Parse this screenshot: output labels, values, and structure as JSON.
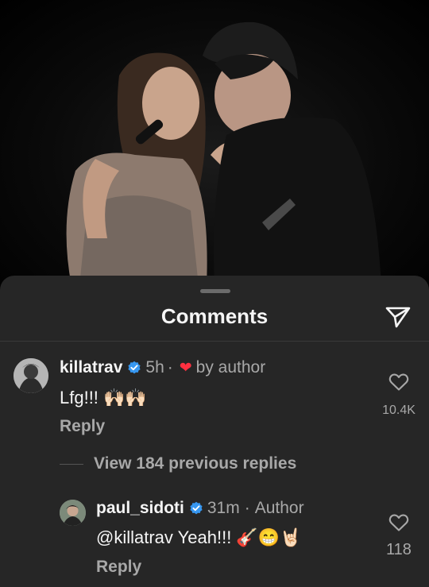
{
  "sheet": {
    "title": "Comments",
    "share_icon": "send-icon"
  },
  "comments": [
    {
      "username": "killatrav",
      "verified": true,
      "time": "5h",
      "separator": "·",
      "liked_by_author": "by author",
      "text": "Lfg!!! 🙌🏻🙌🏻",
      "reply_label": "Reply",
      "like_count": "10.4K"
    }
  ],
  "view_replies": "View 184 previous replies",
  "replies": [
    {
      "username": "paul_sidoti",
      "verified": true,
      "time": "31m",
      "separator": "·",
      "author_tag": "Author",
      "text": "@killatrav Yeah!!! 🎸😁🤘🏻",
      "reply_label": "Reply",
      "like_count": "118"
    }
  ],
  "colors": {
    "sheet_bg": "#262626",
    "verified_blue": "#3797f0",
    "heart_red": "#ff3040",
    "secondary_text": "#a8a8a8"
  }
}
